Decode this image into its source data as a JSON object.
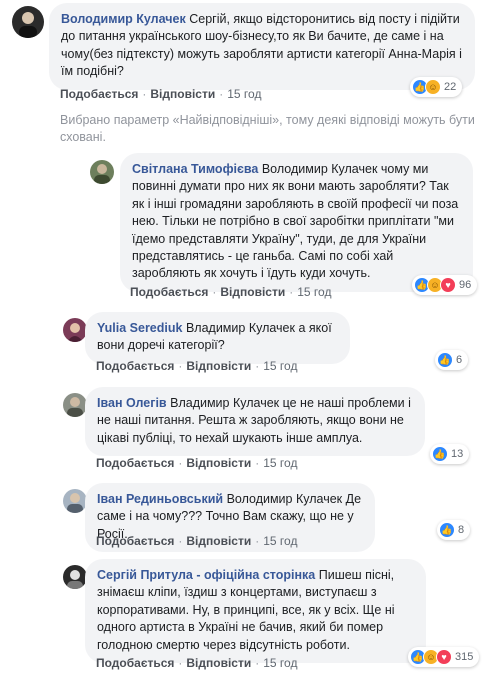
{
  "actions": {
    "like": "Подобається",
    "reply": "Відповісти"
  },
  "notice": "Вибрано параметр «Найвідповідніші», тому деякі відповіді можуть бути сховані.",
  "comments": [
    {
      "author": "Володимир Кулачек",
      "text": "Сергій, якщо відсторонитись від посту і підійти до питання українського шоу-бізнесу,то як Ви бачите, де саме і на чому(без підтексту) можуть заробляти артисти категорії Анна-Марія і їм подібні?",
      "time": "15 год",
      "reactions": [
        "like-icon",
        "haha-icon"
      ],
      "reaction_count": "22"
    },
    {
      "author": "Світлана Тимофієва",
      "text": "Володимир Кулачек чому ми повинні думати про них як вони мають заробляти? Так як і інші громадяни заробляють в своїй професії чи поза нею. Тільки не потрібно в свої заробітки приплітати \"ми їдемо представляти Україну\", туди, де для України представлятись - це ганьба. Самі по собі хай заробляють як хочуть і їдуть куди хочуть.",
      "time": "15 год",
      "reactions": [
        "like-icon",
        "haha-icon",
        "love-icon"
      ],
      "reaction_count": "96"
    },
    {
      "author": "Yulia Serediuk",
      "text": "Владимир Кулачек а якої вони доречі категорії?",
      "time": "15 год",
      "reactions": [
        "like-icon"
      ],
      "reaction_count": "6"
    },
    {
      "author": "Іван Олегів",
      "text": "Владимир Кулачек це не наші проблеми і не наші питання. Решта ж заробляють, якщо вони не цікаві публіці, то нехай шукають інше амплуа.",
      "time": "15 год",
      "reactions": [
        "like-icon"
      ],
      "reaction_count": "13"
    },
    {
      "author": "Іван Рединьовський",
      "text": "Володимир Кулачек Де саме і на чому??? Точно Вам скажу, що не у Росії.",
      "time": "15 год",
      "reactions": [
        "like-icon"
      ],
      "reaction_count": "8"
    },
    {
      "author": "Сергій Притула - офіційна сторінка",
      "text": "Пишеш пісні, знімаєш кліпи, їздиш з концертами, виступаєш з корпоративами. Ну, в принципі, все, як у всіх. Ще ні одного артиста в Україні не бачив, який би помер голодною смертю через відсутність роботи.",
      "time": "15 год",
      "reactions": [
        "like-icon",
        "haha-icon",
        "love-icon"
      ],
      "reaction_count": "315"
    }
  ],
  "colors": {
    "author": "#385898",
    "bubble": "#f2f3f5",
    "like": "#2d88ff",
    "haha": "#f7b125",
    "love": "#f33e58"
  }
}
